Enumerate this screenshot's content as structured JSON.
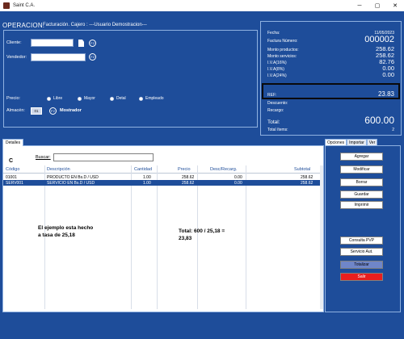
{
  "window": {
    "title": "Saint C.A.",
    "minimize": "─",
    "maximize": "▢",
    "close": "✕"
  },
  "operation": {
    "label": "OPERACION:",
    "description": "Facturación. Cajero : ---Usuario Demostracion---",
    "cliente_label": "Cliente:",
    "cliente_value": "",
    "vendedor_label": "Vendedor:",
    "vendedor_value": "",
    "f2": "F2",
    "precio_label": "Precio:",
    "price_options": [
      "Libre",
      "Mayor",
      "Detal",
      "Empleado"
    ],
    "almacen_label": "Almacén:",
    "almacen_value": "01",
    "mostrador_label": "Mostrador"
  },
  "summary": {
    "fecha_label": "Fecha:",
    "fecha": "11/05/2023",
    "factura_label": "Factura Número:",
    "factura": "000002",
    "productos_label": "Monto productos:",
    "productos": "258.62",
    "servicios_label": "Monto servicios:",
    "servicios": "258.62",
    "iva16_label": "I.V.A(16%)",
    "iva16": "82.76",
    "iva8_label": "I.V.A(8%)",
    "iva8": "0.00",
    "iva24_label": "I.V.A(24%)",
    "iva24": "0.00",
    "ref_label": "REF:",
    "ref": "23.83",
    "descuento_label": "Descuento:",
    "recargo_label": "Recargo:",
    "total_label": "Total:",
    "total": "600.00",
    "items_label": "Total ítems:",
    "items": "2"
  },
  "detail": {
    "tab": "Detalles",
    "search_label": "Buscar:",
    "search_value": "",
    "c_label": "C",
    "columns": [
      "Código",
      "Descripción",
      "Cantidad",
      "Precio",
      "Desc/Recarg.",
      "Subtotal"
    ],
    "rows": [
      {
        "codigo": "01001",
        "descripcion": "PRODUCTO EN Bs.D / USD",
        "cantidad": "1.00",
        "precio": "258.62",
        "desc": "0.00",
        "subtotal": "258.62"
      },
      {
        "codigo": "SERV001",
        "descripcion": "SERVICIO EN Bs.D / USD",
        "cantidad": "1.00",
        "precio": "258.62",
        "desc": "0.00",
        "subtotal": "258.62"
      }
    ],
    "note_left": "El ejemplo esta hecho\na tasa de 25,18",
    "note_right": "Total: 600 / 25,18 =\n23,83"
  },
  "options": {
    "tabs": [
      "Opciones",
      "Importar",
      "Ver"
    ],
    "buttons": [
      "Agregar",
      "Modificar",
      "Borrar",
      "Guardar",
      "Imprimir"
    ],
    "consulta": "Consulta PVP",
    "servicio": "Servicio Aut.",
    "totalizar": "Totalizar",
    "salir": "Salir"
  },
  "colors": {
    "background": "#1e4d9a",
    "selected_row": "#1e4d9a",
    "totalizar": "#6f86c9",
    "salir": "#e81e1e"
  }
}
